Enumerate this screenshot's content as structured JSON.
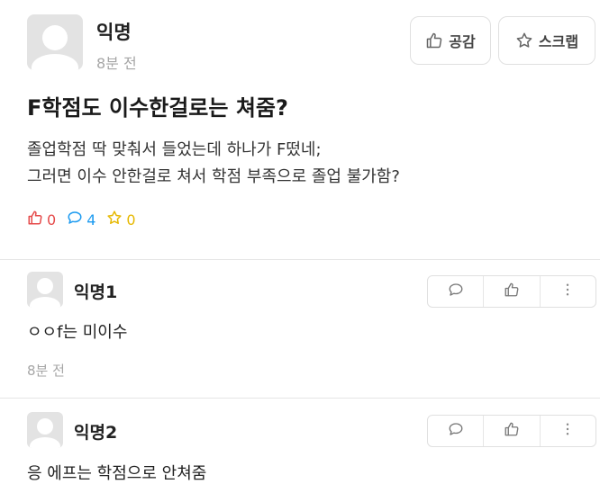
{
  "post": {
    "author": "익명",
    "time": "8분 전",
    "like_button_label": "공감",
    "scrap_button_label": "스크랩",
    "title": "F학점도 이수한걸로는 쳐줌?",
    "body_lines": [
      "졸업학점 딱 맞춰서 들었는데 하나가 F떴네;",
      "그러면 이수 안한걸로 쳐서 학점 부족으로 졸업 불가함?"
    ],
    "stats": {
      "likes": "0",
      "comments": "4",
      "scraps": "0"
    },
    "colors": {
      "like": "#e54b4b",
      "comment": "#1d9bf0",
      "scrap": "#e6b800"
    }
  },
  "comments": [
    {
      "author": "익명1",
      "text": "ㅇㅇf는 미이수",
      "time": "8분 전"
    },
    {
      "author": "익명2",
      "text": "응 에프는 학점으로 안쳐줌"
    }
  ],
  "icons": {
    "header": [
      "thumbs-up-icon",
      "star-icon"
    ],
    "comment_actions": [
      "comment-icon",
      "thumbs-up-icon",
      "more-vertical-icon"
    ]
  }
}
